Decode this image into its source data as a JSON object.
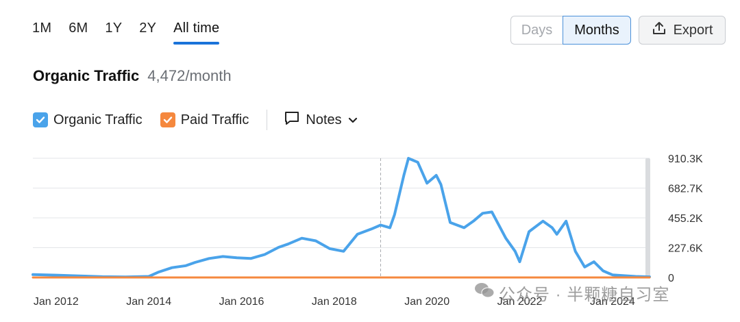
{
  "range_tabs": [
    {
      "label": "1M",
      "active": false
    },
    {
      "label": "6M",
      "active": false
    },
    {
      "label": "1Y",
      "active": false
    },
    {
      "label": "2Y",
      "active": false
    },
    {
      "label": "All time",
      "active": true
    }
  ],
  "granularity": {
    "days_label": "Days",
    "months_label": "Months",
    "selected": "Months"
  },
  "export_label": "Export",
  "metric": {
    "title": "Organic Traffic",
    "value": "4,472/month"
  },
  "legend": {
    "organic": {
      "label": "Organic Traffic",
      "color": "#4aa3ea",
      "checked": true
    },
    "paid": {
      "label": "Paid Traffic",
      "color": "#f5883e",
      "checked": true
    },
    "notes_label": "Notes"
  },
  "watermark": "公众号 · 半颗糖自习室",
  "chart_data": {
    "type": "line",
    "x_tick_labels": [
      "Jan 2012",
      "Jan 2014",
      "Jan 2016",
      "Jan 2018",
      "Jan 2020",
      "Jan 2022",
      "Jan 2024"
    ],
    "y_tick_labels": [
      "910.3K",
      "682.7K",
      "455.2K",
      "227.6K",
      "0"
    ],
    "ylim": [
      0,
      910300
    ],
    "grid": true,
    "series": [
      {
        "name": "Organic Traffic",
        "color": "#4aa3ea",
        "x": [
          2011.5,
          2012.0,
          2012.5,
          2013.0,
          2013.5,
          2014.0,
          2014.2,
          2014.5,
          2014.8,
          2015.0,
          2015.3,
          2015.6,
          2015.9,
          2016.2,
          2016.5,
          2016.8,
          2017.0,
          2017.3,
          2017.6,
          2017.9,
          2018.2,
          2018.5,
          2018.8,
          2019.0,
          2019.2,
          2019.3,
          2019.5,
          2019.6,
          2019.8,
          2020.0,
          2020.2,
          2020.3,
          2020.5,
          2020.8,
          2021.0,
          2021.2,
          2021.4,
          2021.7,
          2021.9,
          2022.0,
          2022.2,
          2022.5,
          2022.7,
          2022.8,
          2023.0,
          2023.2,
          2023.4,
          2023.6,
          2023.8,
          2024.0,
          2024.5,
          2024.8
        ],
        "values": [
          22000,
          18000,
          12000,
          6000,
          4000,
          8000,
          40000,
          75000,
          90000,
          115000,
          145000,
          160000,
          150000,
          145000,
          175000,
          230000,
          255000,
          300000,
          280000,
          220000,
          200000,
          330000,
          370000,
          400000,
          380000,
          480000,
          780000,
          910000,
          880000,
          720000,
          780000,
          710000,
          420000,
          380000,
          430000,
          490000,
          500000,
          300000,
          200000,
          120000,
          350000,
          430000,
          380000,
          330000,
          430000,
          200000,
          80000,
          120000,
          50000,
          20000,
          8000,
          4472
        ]
      },
      {
        "name": "Paid Traffic",
        "color": "#f5883e",
        "x": [
          2011.5,
          2024.8
        ],
        "values": [
          0,
          0
        ]
      }
    ],
    "marker_x": 2019.0
  }
}
